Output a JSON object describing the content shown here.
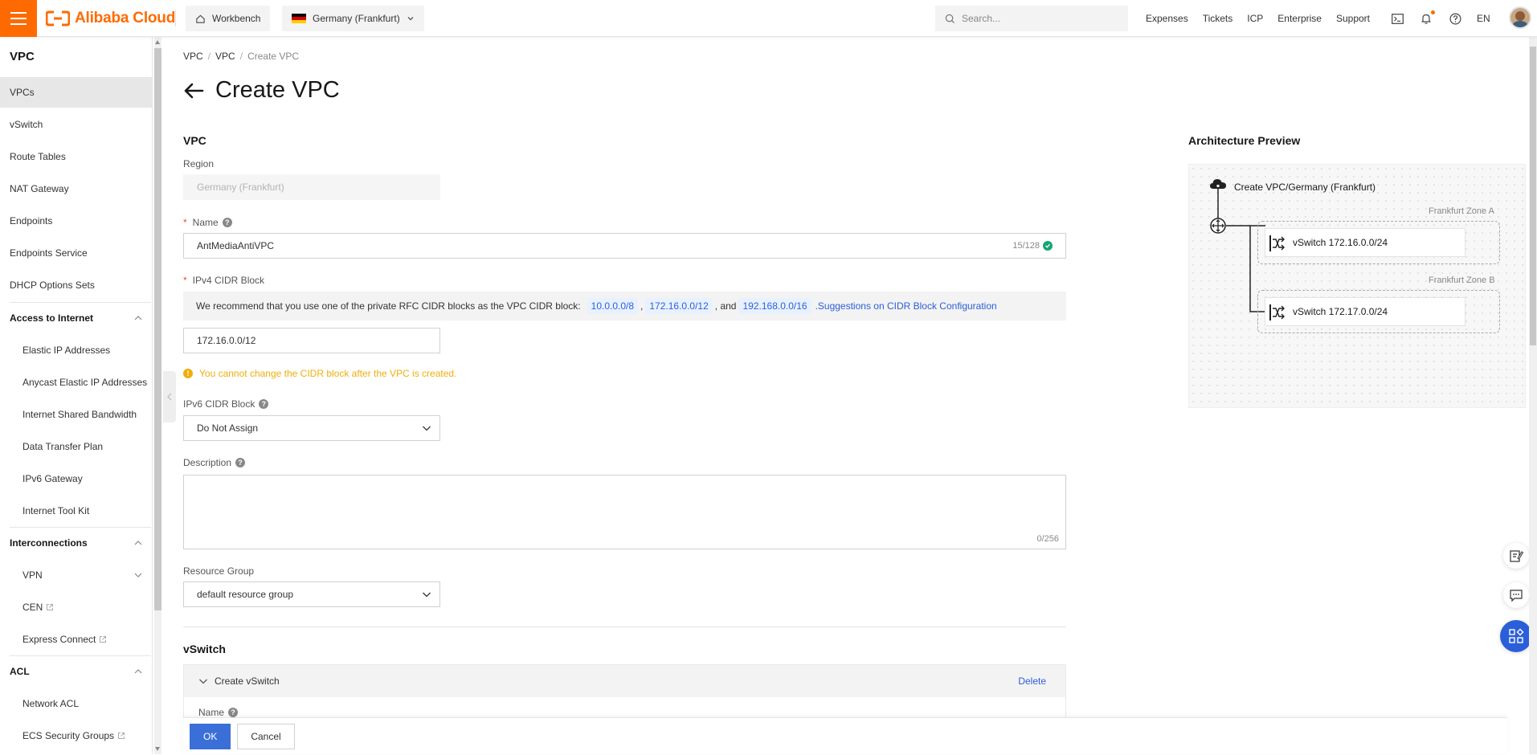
{
  "topbar": {
    "logo_text": "Alibaba Cloud",
    "workbench_label": "Workbench",
    "region_label": "Germany (Frankfurt)",
    "search_placeholder": "Search...",
    "links": [
      "Expenses",
      "Tickets",
      "ICP",
      "Enterprise",
      "Support"
    ],
    "lang": "EN",
    "accent_color": "#ff6a00"
  },
  "sidebar": {
    "title": "VPC",
    "items": [
      {
        "label": "VPCs",
        "active": true
      },
      {
        "label": "vSwitch"
      },
      {
        "label": "Route Tables"
      },
      {
        "label": "NAT Gateway"
      },
      {
        "label": "Endpoints"
      },
      {
        "label": "Endpoints Service"
      },
      {
        "label": "DHCP Options Sets"
      }
    ],
    "groups": [
      {
        "label": "Access to Internet",
        "items": [
          "Elastic IP Addresses",
          "Anycast Elastic IP Addresses",
          "Internet Shared Bandwidth",
          "Data Transfer Plan",
          "IPv6 Gateway",
          "Internet Tool Kit"
        ]
      },
      {
        "label": "Interconnections",
        "items": [
          "VPN",
          "CEN",
          "Express Connect"
        ]
      },
      {
        "label": "ACL",
        "items": [
          "Network ACL",
          "ECS Security Groups"
        ]
      }
    ]
  },
  "breadcrumb": [
    "VPC",
    "VPC",
    "Create VPC"
  ],
  "page_title": "Create VPC",
  "vpc_section": {
    "heading": "VPC",
    "region_label": "Region",
    "region_value": "Germany (Frankfurt)",
    "name_label": "Name",
    "name_value": "AntMediaAntiVPC",
    "name_counter": "15/128",
    "ipv4_label": "IPv4 CIDR Block",
    "hint_text": "We recommend that you use one of the private RFC CIDR blocks as the VPC CIDR block:",
    "cidr_tags": [
      "10.0.0.0/8",
      "172.16.0.0/12",
      "192.168.0.0/16"
    ],
    "hint_comma": ",",
    "hint_and": ", and",
    "hint_link": ".Suggestions on CIDR Block Configuration",
    "ipv4_value": "172.16.0.0/12",
    "warning": "You cannot change the CIDR block after the VPC is created.",
    "ipv6_label": "IPv6 CIDR Block",
    "ipv6_value": "Do Not Assign",
    "description_label": "Description",
    "description_counter": "0/256",
    "resource_group_label": "Resource Group",
    "resource_group_value": "default resource group"
  },
  "vswitch_section": {
    "heading": "vSwitch",
    "panel_title": "Create vSwitch",
    "delete_label": "Delete",
    "name_label": "Name"
  },
  "footer": {
    "ok_label": "OK",
    "cancel_label": "Cancel"
  },
  "architecture": {
    "title": "Architecture Preview",
    "vpc_label": "Create VPC/Germany (Frankfurt)",
    "zones": [
      {
        "label": "Frankfurt Zone A",
        "vswitch": "vSwitch 172.16.0.0/24"
      },
      {
        "label": "Frankfurt Zone B",
        "vswitch": "vSwitch 172.17.0.0/24"
      }
    ]
  }
}
